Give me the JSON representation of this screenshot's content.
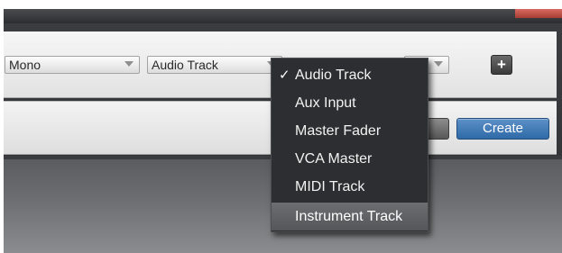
{
  "dialog": {
    "channel_select": {
      "value": "Mono"
    },
    "track_type_select": {
      "value": "Audio Track"
    },
    "add_button": {
      "label": "+"
    },
    "create_button": {
      "label": "Create"
    }
  },
  "dropdown": {
    "items": [
      {
        "label": "Audio Track",
        "checked": true
      },
      {
        "label": "Aux Input",
        "checked": false
      },
      {
        "label": "Master Fader",
        "checked": false
      },
      {
        "label": "VCA Master",
        "checked": false
      },
      {
        "label": "MIDI Track",
        "checked": false
      },
      {
        "label": "Instrument Track",
        "checked": false,
        "highlighted": true
      }
    ],
    "check_glyph": "✓"
  },
  "colors": {
    "accent_blue": "#2f6aa7",
    "menu_bg": "#2d2e31",
    "menu_highlight": "#5f6064"
  }
}
